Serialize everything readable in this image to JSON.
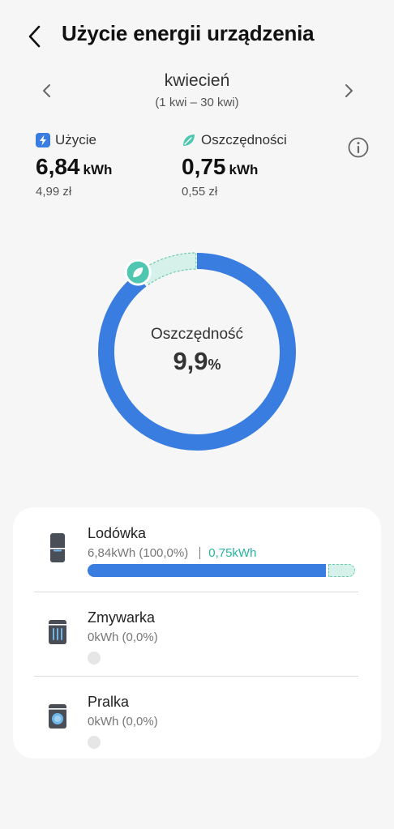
{
  "header": {
    "title": "Użycie energii urządzenia"
  },
  "period": {
    "month": "kwiecień",
    "range": "(1 kwi – 30 kwi)"
  },
  "usage": {
    "label": "Użycie",
    "value": "6,84",
    "unit": "kWh",
    "cost": "4,99 zł",
    "icon": "lightning-icon",
    "color": "#3a7de0"
  },
  "saving": {
    "label": "Oszczędności",
    "value": "0,75",
    "unit": "kWh",
    "cost": "0,55 zł",
    "icon": "leaf-icon",
    "color": "#4fc7b0"
  },
  "donut": {
    "label": "Oszczędność",
    "value": "9,9",
    "unit": "%",
    "saving_fraction": 0.099
  },
  "devices": [
    {
      "name": "Lodówka",
      "usage": "6,84kWh (100,0%)",
      "saving": "0,75kWh",
      "icon": "fridge-icon",
      "usage_fraction": 0.901,
      "saving_fraction": 0.099
    },
    {
      "name": "Zmywarka",
      "usage": "0kWh (0,0%)",
      "icon": "dishwasher-icon",
      "usage_fraction": 0
    },
    {
      "name": "Pralka",
      "usage": "0kWh (0,0%)",
      "icon": "washing-machine-icon",
      "usage_fraction": 0
    }
  ]
}
